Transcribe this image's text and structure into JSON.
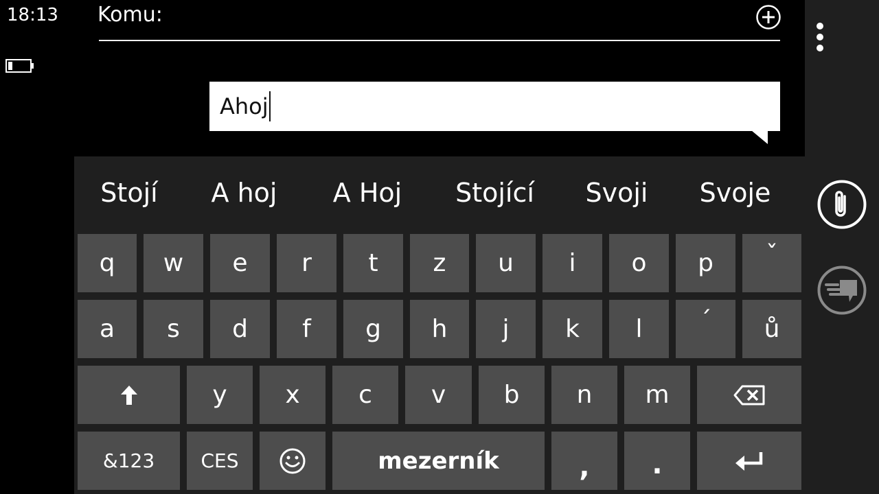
{
  "status": {
    "time": "18:13"
  },
  "recipient": {
    "label": "Komu:"
  },
  "message": {
    "text": "Ahoj"
  },
  "suggestions": [
    "Stojí",
    "A hoj",
    "A Hoj",
    "Stojící",
    "Svoji",
    "Svoje"
  ],
  "keyboard": {
    "row1": [
      "q",
      "w",
      "e",
      "r",
      "t",
      "z",
      "u",
      "i",
      "o",
      "p",
      "ˇ"
    ],
    "row2": [
      "a",
      "s",
      "d",
      "f",
      "g",
      "h",
      "j",
      "k",
      "l",
      "´",
      "ů"
    ],
    "row3": [
      "y",
      "x",
      "c",
      "v",
      "b",
      "n",
      "m"
    ],
    "symbols_label": "&123",
    "language_label": "CES",
    "space_label": "mezerník",
    "comma_label": ",",
    "period_label": "."
  },
  "icons": {
    "add": "plus-circle-icon",
    "more": "ellipsis-vertical-icon",
    "attach": "paperclip-icon",
    "voice": "speech-to-text-icon",
    "battery": "battery-icon",
    "shift": "shift-arrow-icon",
    "backspace": "backspace-icon",
    "emoji": "smiley-icon",
    "enter": "enter-icon"
  },
  "colors": {
    "background": "#000000",
    "keyboard": "#1f1f1f",
    "key": "#4d4d4d",
    "text": "#ffffff",
    "bubble": "#ffffff"
  }
}
